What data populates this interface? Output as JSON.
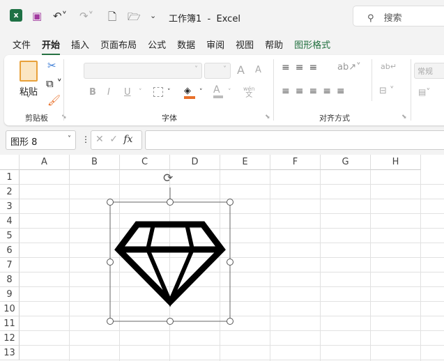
{
  "title_bar": {
    "title": "工作簿1  -  Excel",
    "search_placeholder": "搜索"
  },
  "tabs": [
    {
      "label": "文件"
    },
    {
      "label": "开始",
      "active": true
    },
    {
      "label": "插入"
    },
    {
      "label": "页面布局"
    },
    {
      "label": "公式"
    },
    {
      "label": "数据"
    },
    {
      "label": "审阅"
    },
    {
      "label": "视图"
    },
    {
      "label": "帮助"
    },
    {
      "label": "图形格式",
      "contextual": true
    }
  ],
  "ribbon": {
    "clipboard": {
      "label": "剪贴板",
      "paste": "粘贴"
    },
    "font": {
      "label": "字体",
      "bold": "B",
      "italic": "I",
      "underline": "U",
      "phonetic_top": "wén",
      "phonetic_bottom": "文",
      "grow": "A",
      "shrink": "A"
    },
    "alignment": {
      "label": "对齐方式"
    },
    "number": {
      "format": "常规"
    }
  },
  "formula_bar": {
    "name_box": "图形 8",
    "fx": "fx",
    "value": ""
  },
  "columns": [
    "A",
    "B",
    "C",
    "D",
    "E",
    "F",
    "G",
    "H"
  ],
  "rows": [
    "1",
    "2",
    "3",
    "4",
    "5",
    "6",
    "7",
    "8",
    "9",
    "10",
    "11",
    "12",
    "13"
  ],
  "colors": {
    "accent": "#1e6e3c",
    "fill_color": "#e8702a"
  }
}
